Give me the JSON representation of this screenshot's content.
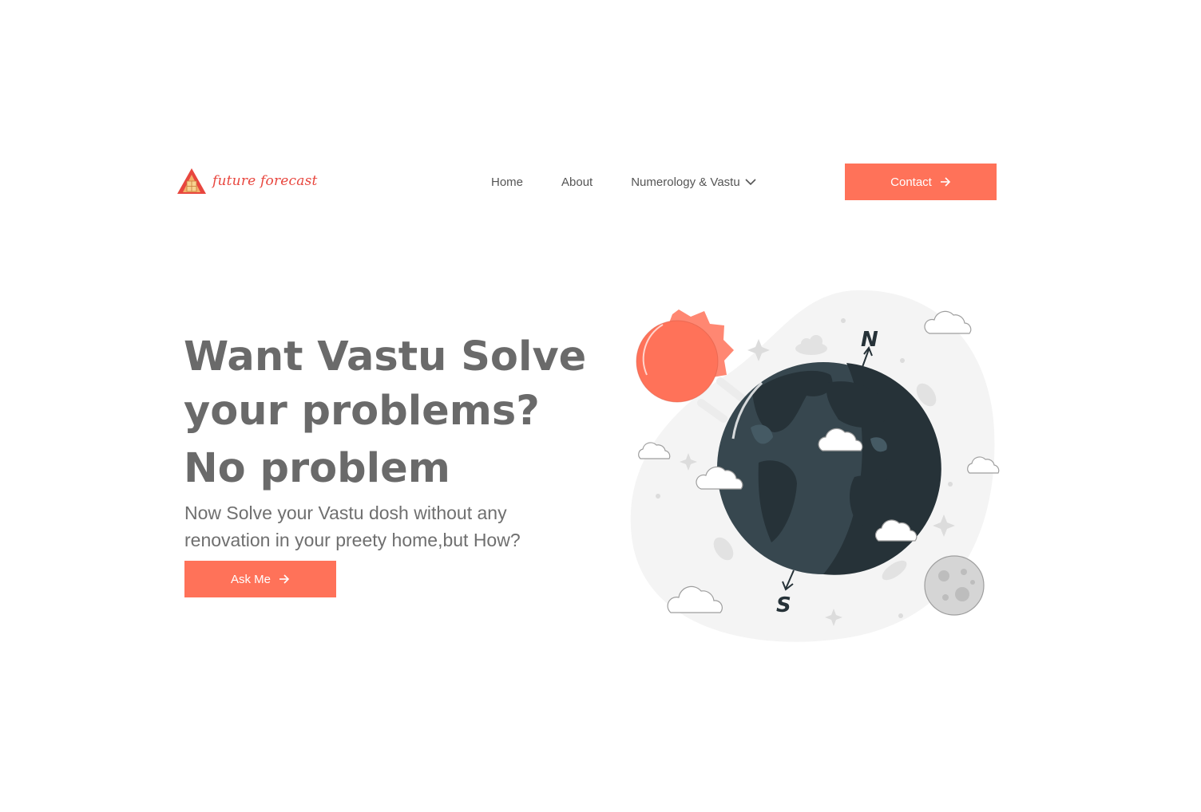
{
  "header": {
    "logo_text": "future forecast",
    "nav": [
      {
        "label": "Home"
      },
      {
        "label": "About"
      },
      {
        "label": "Numerology & Vastu"
      }
    ],
    "contact_label": "Contact"
  },
  "hero": {
    "title_lines": [
      "Want Vastu Solve",
      "your problems?",
      "No problem"
    ],
    "subtitle": "Now Solve your Vastu dosh without any renovation in your preety home,but How?",
    "cta_label": "Ask Me"
  },
  "illustration": {
    "north_label": "N",
    "south_label": "S"
  },
  "colors": {
    "accent": "#ff7259",
    "logo": "#e8463e",
    "heading": "#6a6a6a",
    "earth_dark": "#263238"
  }
}
